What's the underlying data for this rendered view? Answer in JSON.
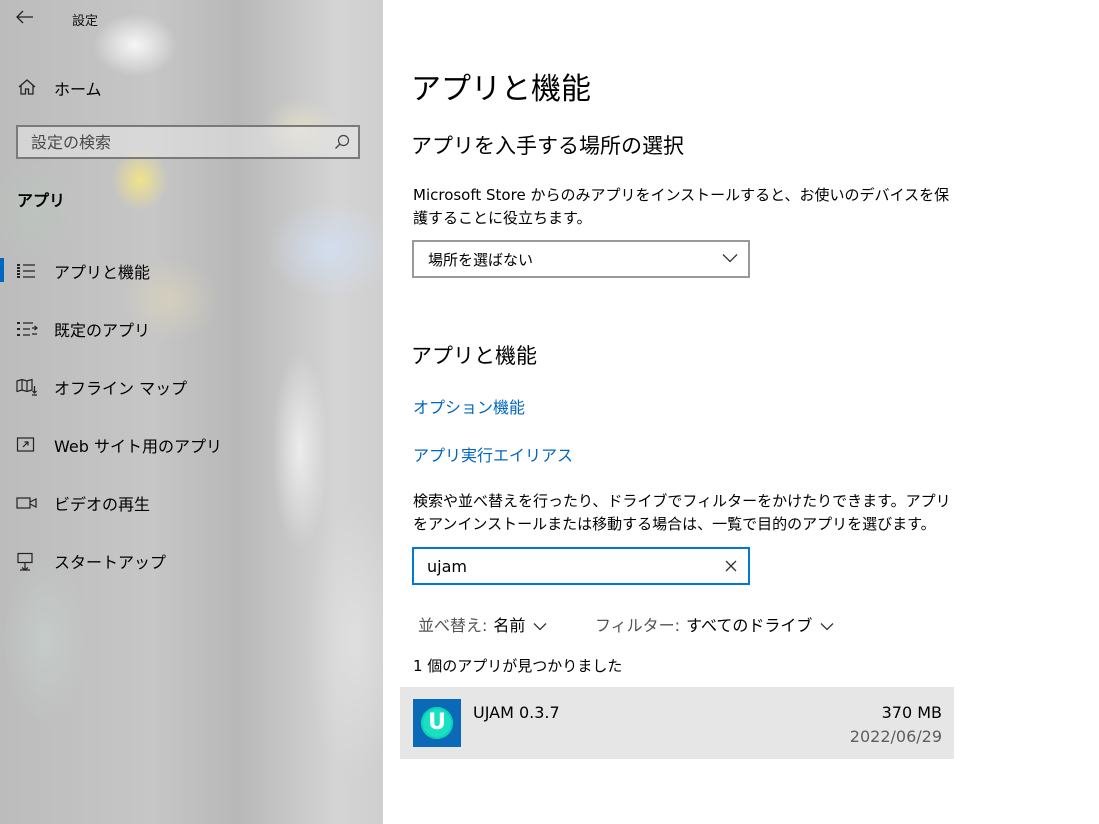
{
  "window": {
    "title": "設定"
  },
  "sidebar": {
    "home_label": "ホーム",
    "search_placeholder": "設定の検索",
    "section_title": "アプリ",
    "items": [
      {
        "label": "アプリと機能",
        "icon": "apps-list-icon",
        "active": true
      },
      {
        "label": "既定のアプリ",
        "icon": "default-apps-icon",
        "active": false
      },
      {
        "label": "オフライン マップ",
        "icon": "offline-maps-icon",
        "active": false
      },
      {
        "label": "Web サイト用のアプリ",
        "icon": "web-apps-icon",
        "active": false
      },
      {
        "label": "ビデオの再生",
        "icon": "video-icon",
        "active": false
      },
      {
        "label": "スタートアップ",
        "icon": "startup-icon",
        "active": false
      }
    ]
  },
  "main": {
    "page_title": "アプリと機能",
    "install_section": {
      "heading": "アプリを入手する場所の選択",
      "description": "Microsoft Store からのみアプリをインストールすると、お使いのデバイスを保護することに役立ちます。",
      "dropdown_value": "場所を選ばない"
    },
    "apps_section": {
      "heading": "アプリと機能",
      "link_optional": "オプション機能",
      "link_aliases": "アプリ実行エイリアス",
      "description": "検索や並べ替えを行ったり、ドライブでフィルターをかけたりできます。アプリをアンインストールまたは移動する場合は、一覧で目的のアプリを選びます。",
      "search_value": "ujam",
      "sort_label": "並べ替え:",
      "sort_value": "名前",
      "filter_label": "フィルター:",
      "filter_value": "すべてのドライブ",
      "result_count": "1 個のアプリが見つかりました",
      "apps": [
        {
          "name": "UJAM 0.3.7",
          "size": "370 MB",
          "date": "2022/06/29",
          "icon_letter": "U"
        }
      ]
    }
  },
  "colors": {
    "accent": "#0067c0",
    "link": "#0067c0",
    "focus_border": "#0078d7",
    "selected_row": "#e6e6e6"
  }
}
